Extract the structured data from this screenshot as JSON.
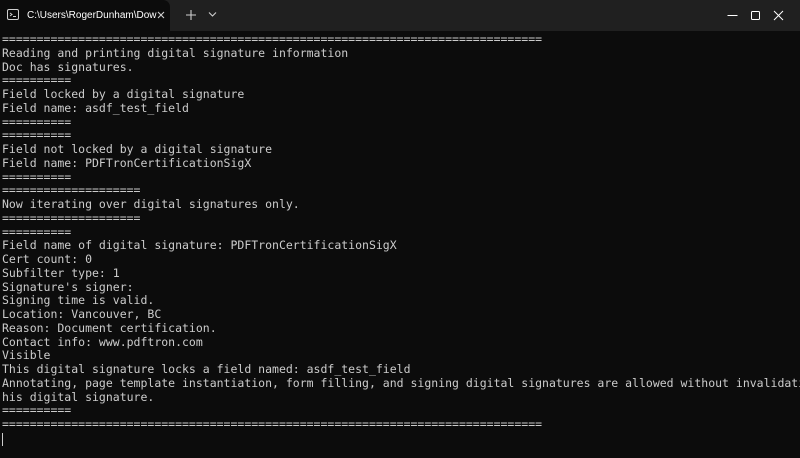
{
  "window": {
    "tab_title": "C:\\Users\\RogerDunham\\Dow",
    "tab_icon": "terminal-icon",
    "new_tab_icon": "plus-icon",
    "dropdown_icon": "chevron-down-icon",
    "controls": [
      "minimize-icon",
      "maximize-icon",
      "close-icon"
    ]
  },
  "terminal": {
    "lines": [
      "==============================================================================",
      "Reading and printing digital signature information",
      "Doc has signatures.",
      "==========",
      "Field locked by a digital signature",
      "Field name: asdf_test_field",
      "==========",
      "==========",
      "Field not locked by a digital signature",
      "Field name: PDFTronCertificationSigX",
      "==========",
      "====================",
      "Now iterating over digital signatures only.",
      "====================",
      "==========",
      "Field name of digital signature: PDFTronCertificationSigX",
      "Cert count: 0",
      "Subfilter type: 1",
      "Signature's signer:",
      "Signing time is valid.",
      "Location: Vancouver, BC",
      "Reason: Document certification.",
      "Contact info: www.pdftron.com",
      "Visible",
      "This digital signature locks a field named: asdf_test_field",
      "Annotating, page template instantiation, form filling, and signing digital signatures are allowed without invalidating t",
      "his digital signature.",
      "==========",
      "=============================================================================="
    ]
  }
}
